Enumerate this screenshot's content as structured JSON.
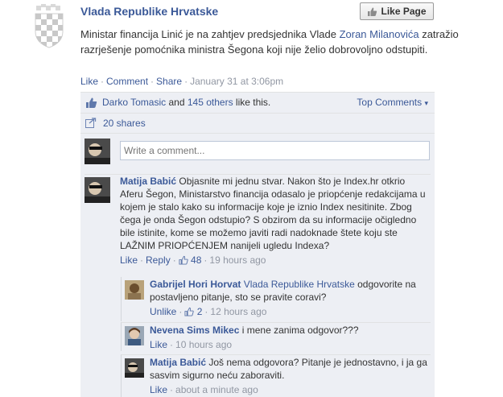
{
  "post": {
    "page_name": "Vlada Republike Hrvatske",
    "like_page_label": "Like Page",
    "text_before": "Ministar financija Linić je na zahtjev predsjednika Vlade ",
    "text_link": "Zoran Milanovića",
    "text_after": " zatražio razrješenje pomoćnika ministra Šegona koji nije želio dobrovoljno odstupiti.",
    "actions": {
      "like": "Like",
      "comment": "Comment",
      "share": "Share",
      "timestamp": "January 31 at 3:06pm"
    }
  },
  "ufi": {
    "liker": "Darko Tomasic",
    "and_text": "and",
    "others": "145 others",
    "like_this": "like this.",
    "top_comments": "Top Comments",
    "shares": "20 shares",
    "write_placeholder": "Write a comment..."
  },
  "comments": [
    {
      "author": "Matija Babić",
      "text": "Objasnite mi jednu stvar. Nakon što je Index.hr otkrio Aferu Šegon, Ministarstvo financija odasalo je priopćenje redakcijama u kojem je stalo kako su informacije koje je iznio Index nesitinite. Zbog čega je onda Šegon odstupio? S obzirom da su informacije očigledno bile istinite, kome se možemo javiti radi nadoknade štete koju ste LAŽNIM PRIOPĆENJEM nanijeli ugledu Indexa?",
      "like": "Like",
      "reply": "Reply",
      "likes": "48",
      "time": "19 hours ago"
    }
  ],
  "replies": [
    {
      "author": "Gabrijel Hori Horvat",
      "mention": "Vlada Republike Hrvatske",
      "text": " odgovorite na postavljeno pitanje, sto se pravite coravi?",
      "like": "Unlike",
      "likes": "2",
      "time": "12 hours ago"
    },
    {
      "author": "Nevena Sims Mikec",
      "text": "i mene zanima odgovor???",
      "like": "Like",
      "time": "10 hours ago"
    },
    {
      "author": "Matija Babić",
      "text": "Još nema odgovora? Pitanje je jednostavno, i ja ga sasvim sigurno neću zaboraviti.",
      "like": "Like",
      "time": "about a minute ago"
    }
  ]
}
